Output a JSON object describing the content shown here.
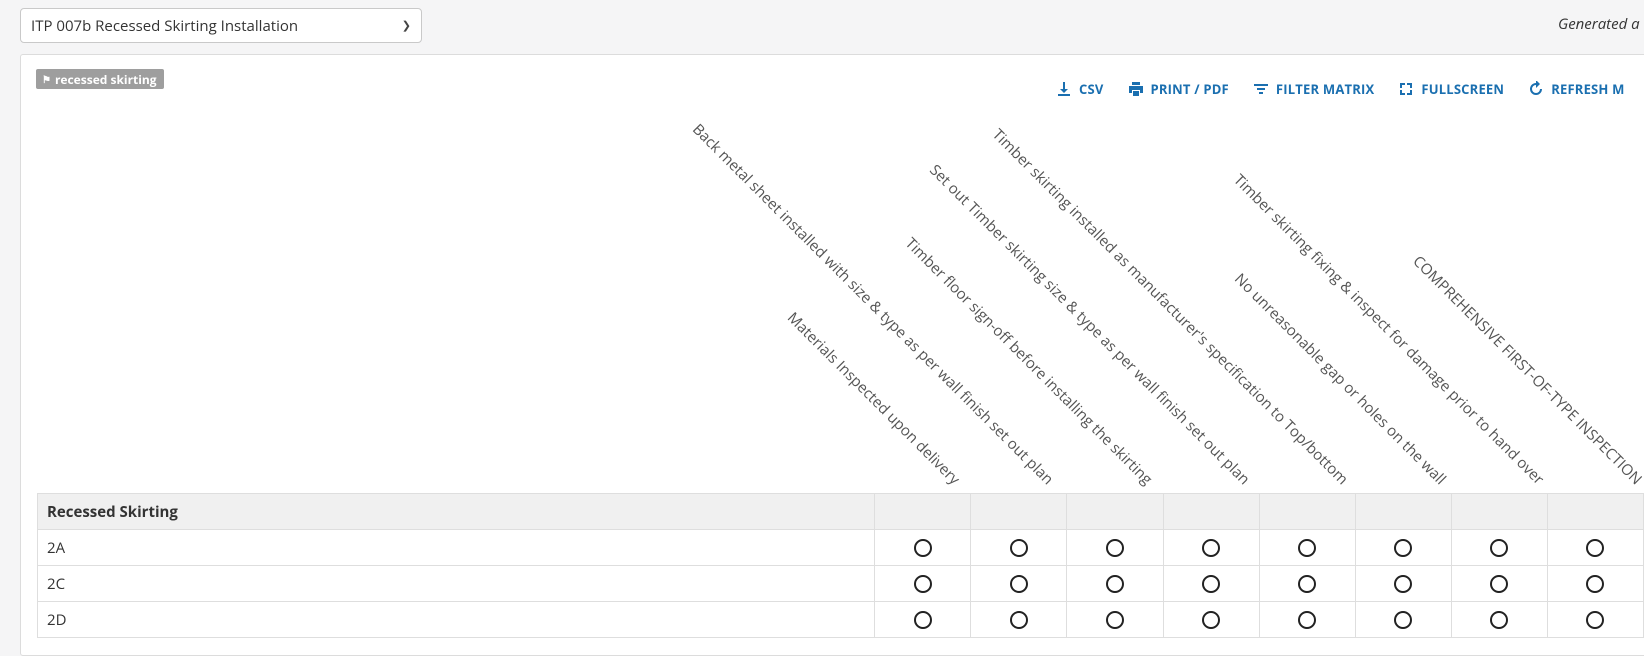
{
  "selector": {
    "value": "ITP 007b Recessed Skirting Installation"
  },
  "generated_text": "Generated a",
  "tag": {
    "label": "recessed skirting",
    "icon": "tag-icon"
  },
  "toolbar": [
    {
      "label": "CSV",
      "icon": "download-icon"
    },
    {
      "label": "PRINT / PDF",
      "icon": "printer-icon"
    },
    {
      "label": "FILTER MATRIX",
      "icon": "filter-icon"
    },
    {
      "label": "FULLSCREEN",
      "icon": "fullscreen-icon"
    },
    {
      "label": "REFRESH M",
      "icon": "refresh-icon"
    }
  ],
  "columns": [
    "Materials Inspected upon delivery",
    "Back metal sheet installed with size & type as per wall finish set out plan",
    "Timber floor sign-off before installing the skirting",
    "Set out Timber skirting size & type as per wall finish set out plan",
    "Timber skirting installed as manufacturer's specification to Top/bottom",
    "No unreasonable gap or holes on the wall",
    "Timber skirting fixing & inspect for damage prior to hand over",
    "COMPREHENSIVE FIRST-OF-TYPE INSPECTION"
  ],
  "group": {
    "label": "Recessed Skirting"
  },
  "rows": [
    {
      "label": "2A"
    },
    {
      "label": "2C"
    },
    {
      "label": "2D"
    }
  ]
}
